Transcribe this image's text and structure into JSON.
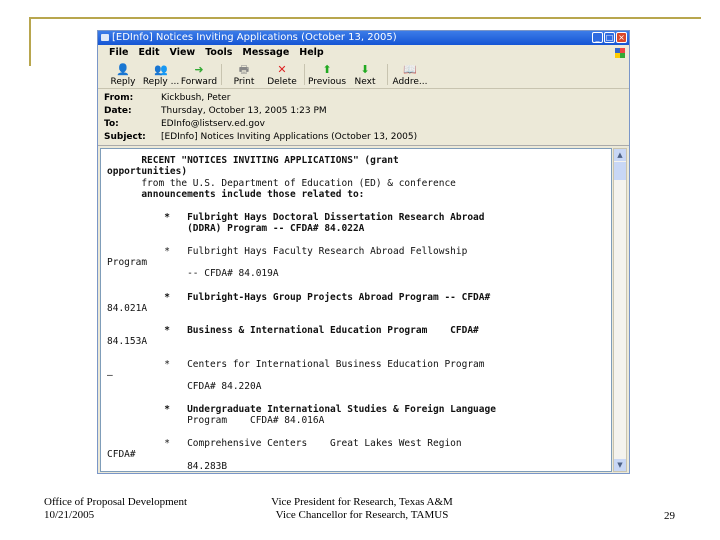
{
  "window": {
    "title": "[EDInfo] Notices Inviting Applications (October 13, 2005)"
  },
  "menu": [
    "File",
    "Edit",
    "View",
    "Tools",
    "Message",
    "Help"
  ],
  "toolbar": [
    {
      "label": "Reply",
      "icon": "reply-icon",
      "glyph": "👤"
    },
    {
      "label": "Reply ...",
      "icon": "reply-all-icon",
      "glyph": "👥"
    },
    {
      "label": "Forward",
      "icon": "forward-icon",
      "glyph": "➜"
    },
    {
      "label": "Print",
      "icon": "print-icon",
      "glyph": "🖶"
    },
    {
      "label": "Delete",
      "icon": "delete-icon",
      "glyph": "✕"
    },
    {
      "label": "Previous",
      "icon": "previous-icon",
      "glyph": "⬆"
    },
    {
      "label": "Next",
      "icon": "next-icon",
      "glyph": "⬇"
    },
    {
      "label": "Addre...",
      "icon": "address-book-icon",
      "glyph": "📖"
    }
  ],
  "headers": [
    {
      "label": "From:",
      "value": "Kickbush, Peter"
    },
    {
      "label": "Date:",
      "value": "Thursday, October 13, 2005 1:23 PM"
    },
    {
      "label": "To:",
      "value": "EDInfo@listserv.ed.gov"
    },
    {
      "label": "Subject:",
      "value": "[EDInfo] Notices Inviting Applications (October 13, 2005)"
    }
  ],
  "body_lines": [
    "      RECENT \"NOTICES INVITING APPLICATIONS\" (grant",
    "opportunities)",
    "      from the U.S. Department of Education (ED) & conference",
    "      announcements include those related to:",
    "          *   Fulbright Hays Doctoral Dissertation Research Abroad",
    "              (DDRA) Program -- CFDA# 84.022A",
    "          *   Fulbright Hays Faculty Research Abroad Fellowship",
    "Program",
    "              -- CFDA# 84.019A",
    "          *   Fulbright-Hays Group Projects Abroad Program -- CFDA#",
    "84.021A",
    "          *   Business & International Education Program    CFDA#",
    "84.153A",
    "          *   Centers for International Business Education Program",
    "–",
    "              CFDA# 84.220A",
    "          *   Undergraduate International Studies & Foreign Language",
    "              Program    CFDA# 84.016A",
    "          *   Comprehensive Centers    Great Lakes West Region",
    "CFDA#",
    "              84.283B"
  ],
  "footer": {
    "left_line1": "Office of Proposal Development",
    "left_line2": "10/21/2005",
    "center_line1": "Vice President for Research, Texas A&M",
    "center_line2": "Vice Chancellor for Research, TAMUS",
    "page": "29"
  }
}
